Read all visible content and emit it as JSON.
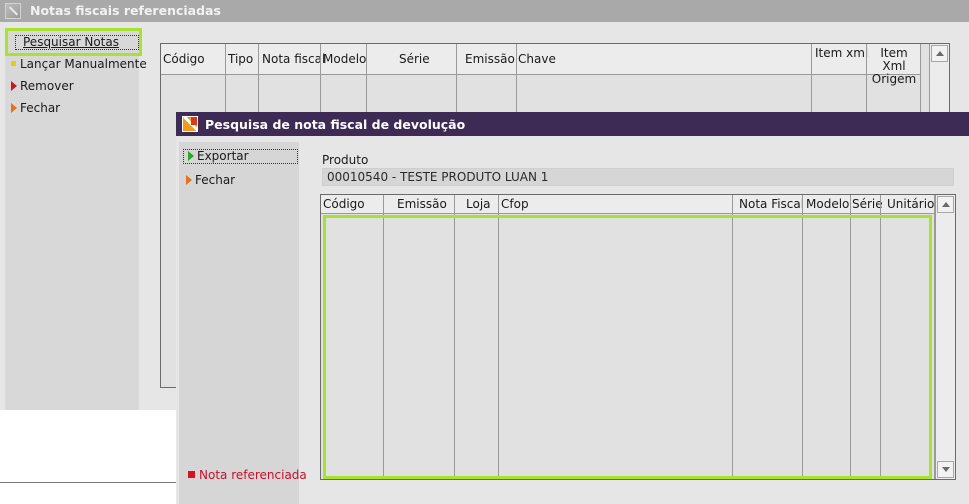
{
  "background_window": {
    "title": "Notas fiscais referenciadas",
    "sidebar": {
      "items": [
        {
          "label": "Pesquisar Notas"
        },
        {
          "label": "Lançar Manualmente"
        },
        {
          "label": "Remover"
        },
        {
          "label": "Fechar"
        }
      ]
    },
    "grid": {
      "columns": [
        "Código",
        "Tipo",
        "Nota fiscal",
        "Modelo",
        "Série",
        "Emissão",
        "Chave",
        "Item xml",
        "Item Xml Origem"
      ]
    }
  },
  "dialog": {
    "title": "Pesquisa de nota fiscal de devolução",
    "sidebar": {
      "export_label": "Exportar",
      "close_label": "Fechar",
      "legend_label": "Nota referenciada"
    },
    "produto": {
      "label": "Produto",
      "value": "00010540 - TESTE PRODUTO LUAN 1"
    },
    "grid": {
      "columns": [
        "Código",
        "Emissão",
        "Loja",
        "Cfop",
        "Nota Fiscal",
        "Modelo",
        "Série",
        "Unitário"
      ]
    }
  },
  "colors": {
    "highlight": "#a6e22e",
    "dialog_titlebar": "#3d2a55",
    "legend_red": "#c8102e"
  }
}
